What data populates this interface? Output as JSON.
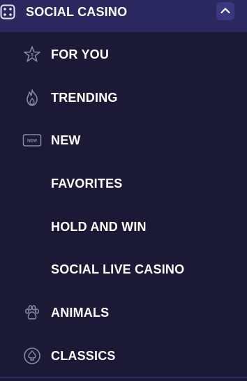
{
  "header": {
    "title": "SOCIAL CASINO",
    "icon": "dice-icon",
    "collapse_icon": "chevron-up-icon"
  },
  "items": [
    {
      "label": "FOR YOU",
      "icon": "star-icon"
    },
    {
      "label": "TRENDING",
      "icon": "flame-icon"
    },
    {
      "label": "NEW",
      "icon": "new-badge-icon",
      "badge_text": "NEW"
    },
    {
      "label": "FAVORITES",
      "icon": ""
    },
    {
      "label": "HOLD AND WIN",
      "icon": ""
    },
    {
      "label": "SOCIAL LIVE CASINO",
      "icon": ""
    },
    {
      "label": "ANIMALS",
      "icon": "paw-icon"
    },
    {
      "label": "CLASSICS",
      "icon": "spade-icon"
    }
  ],
  "colors": {
    "background": "#1b1936",
    "header_background": "#2b2860",
    "button_background": "#3b3880",
    "text": "#ffffff",
    "icon": "#8a88a8"
  }
}
